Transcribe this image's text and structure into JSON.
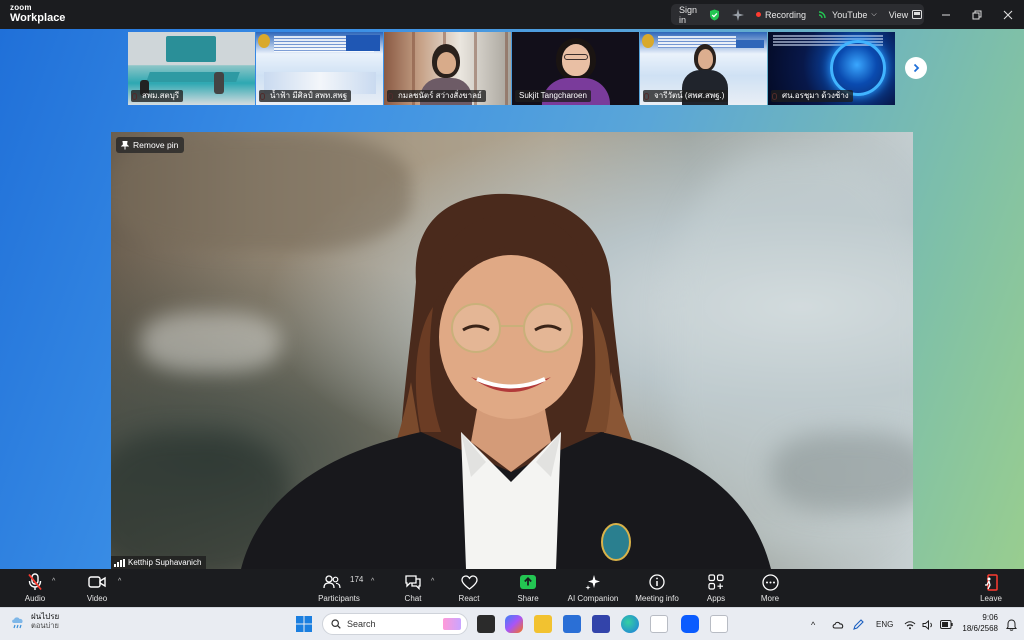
{
  "app": {
    "brand_small": "zoom",
    "brand_large": "Workplace"
  },
  "titlebar": {
    "sign_in": "Sign in",
    "recording": "Recording",
    "youtube": "YouTube",
    "view": "View"
  },
  "thumbnails": [
    {
      "name": "สพม.สตบุรี"
    },
    {
      "name": "น้ำฟ้า มีศิลป์ สพท.สพฐ"
    },
    {
      "name": "กมลชนัตร์ สว่างสั่งขาลย์"
    },
    {
      "name": "Sukjit Tangcharoen"
    },
    {
      "name": "จารีวัตน์ (สพศ.สพฐ.)"
    },
    {
      "name": "ศน.อรชุมา ด้วงช้าง"
    }
  ],
  "main_video": {
    "pin_label": "Remove pin",
    "participant_name": "Ketthip Suphavanich"
  },
  "toolbar": {
    "audio": "Audio",
    "video": "Video",
    "participants": "Participants",
    "participants_count": "174",
    "chat": "Chat",
    "react": "React",
    "share": "Share",
    "ai_companion": "AI Companion",
    "meeting_info": "Meeting info",
    "apps": "Apps",
    "more": "More",
    "leave": "Leave"
  },
  "taskbar": {
    "weather_line1": "ฝนไปรย",
    "weather_line2": "ตอนบ่าย",
    "search_placeholder": "Search",
    "language": "ENG",
    "time": "9:06",
    "date": "18/6/2568"
  },
  "colors": {
    "toolbar_bg": "#1b1c1f",
    "share_green": "#23c552",
    "recording_red": "#ff3b30",
    "zoom_blue": "#0b5cff"
  }
}
